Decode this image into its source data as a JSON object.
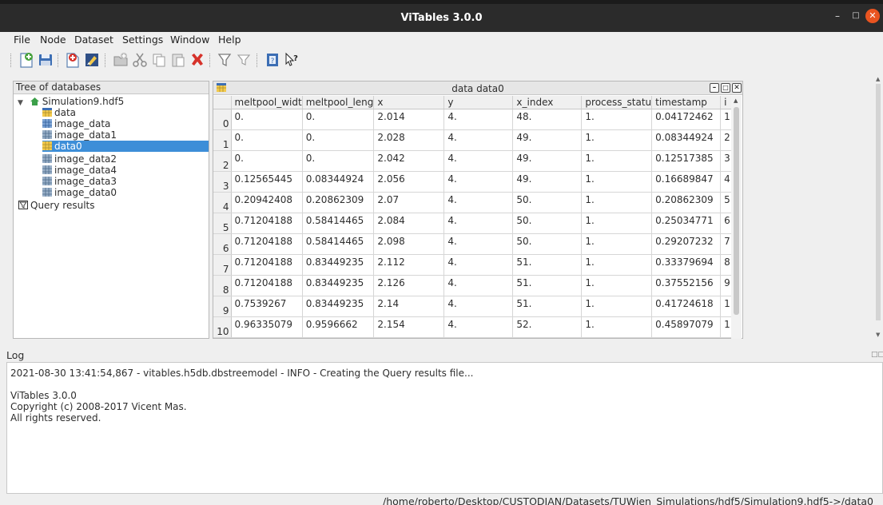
{
  "window": {
    "title": "ViTables 3.0.0"
  },
  "menubar": {
    "items": [
      "File",
      "Node",
      "Dataset",
      "Settings",
      "Window",
      "Help"
    ]
  },
  "toolbar": {
    "buttons": [
      "new-file",
      "save",
      "open",
      "export",
      "new-group",
      "cut",
      "copy",
      "paste",
      "delete",
      "query",
      "query-filter",
      "help",
      "whats-this"
    ]
  },
  "tree": {
    "header": "Tree of databases",
    "root": "Simulation9.hdf5",
    "nodes": [
      "data",
      "image_data",
      "image_data1",
      "data0",
      "image_data2",
      "image_data4",
      "image_data3",
      "image_data0"
    ],
    "selected": "data0",
    "query_results": "Query results"
  },
  "dataset_window": {
    "title": "data data0",
    "columns": [
      "meltpool_widt",
      "meltpool_leng",
      "x",
      "y",
      "x_index",
      "process_statu",
      "timestamp",
      "i"
    ],
    "row_headers": [
      "0",
      "1",
      "2",
      "3",
      "4",
      "5",
      "6",
      "7",
      "8",
      "9",
      "10"
    ],
    "rows": [
      [
        "0.",
        "0.",
        "2.014",
        "4.",
        "48.",
        "1.",
        "0.04172462",
        "1"
      ],
      [
        "0.",
        "0.",
        "2.028",
        "4.",
        "49.",
        "1.",
        "0.08344924",
        "2"
      ],
      [
        "0.",
        "0.",
        "2.042",
        "4.",
        "49.",
        "1.",
        "0.12517385",
        "3"
      ],
      [
        "0.12565445",
        "0.08344924",
        "2.056",
        "4.",
        "49.",
        "1.",
        "0.16689847",
        "4"
      ],
      [
        "0.20942408",
        "0.20862309",
        "2.07",
        "4.",
        "50.",
        "1.",
        "0.20862309",
        "5"
      ],
      [
        "0.71204188",
        "0.58414465",
        "2.084",
        "4.",
        "50.",
        "1.",
        "0.25034771",
        "6"
      ],
      [
        "0.71204188",
        "0.58414465",
        "2.098",
        "4.",
        "50.",
        "1.",
        "0.29207232",
        "7"
      ],
      [
        "0.71204188",
        "0.83449235",
        "2.112",
        "4.",
        "51.",
        "1.",
        "0.33379694",
        "8"
      ],
      [
        "0.71204188",
        "0.83449235",
        "2.126",
        "4.",
        "51.",
        "1.",
        "0.37552156",
        "9"
      ],
      [
        "0.7539267",
        "0.83449235",
        "2.14",
        "4.",
        "51.",
        "1.",
        "0.41724618",
        "1"
      ],
      [
        "0.96335079",
        "0.9596662",
        "2.154",
        "4.",
        "52.",
        "1.",
        "0.45897079",
        "1"
      ]
    ]
  },
  "log": {
    "label": "Log",
    "lines": [
      "2021-08-30 13:41:54,867 - vitables.h5db.dbstreemodel - INFO - Creating the Query results file...",
      "",
      "ViTables 3.0.0",
      "Copyright (c) 2008-2017 Vicent Mas.",
      "All rights reserved."
    ]
  },
  "status": {
    "path": "/home/roberto/Desktop/CUSTODIAN/Datasets/TUWien_Simulations/hdf5/Simulation9.hdf5->/data0"
  }
}
